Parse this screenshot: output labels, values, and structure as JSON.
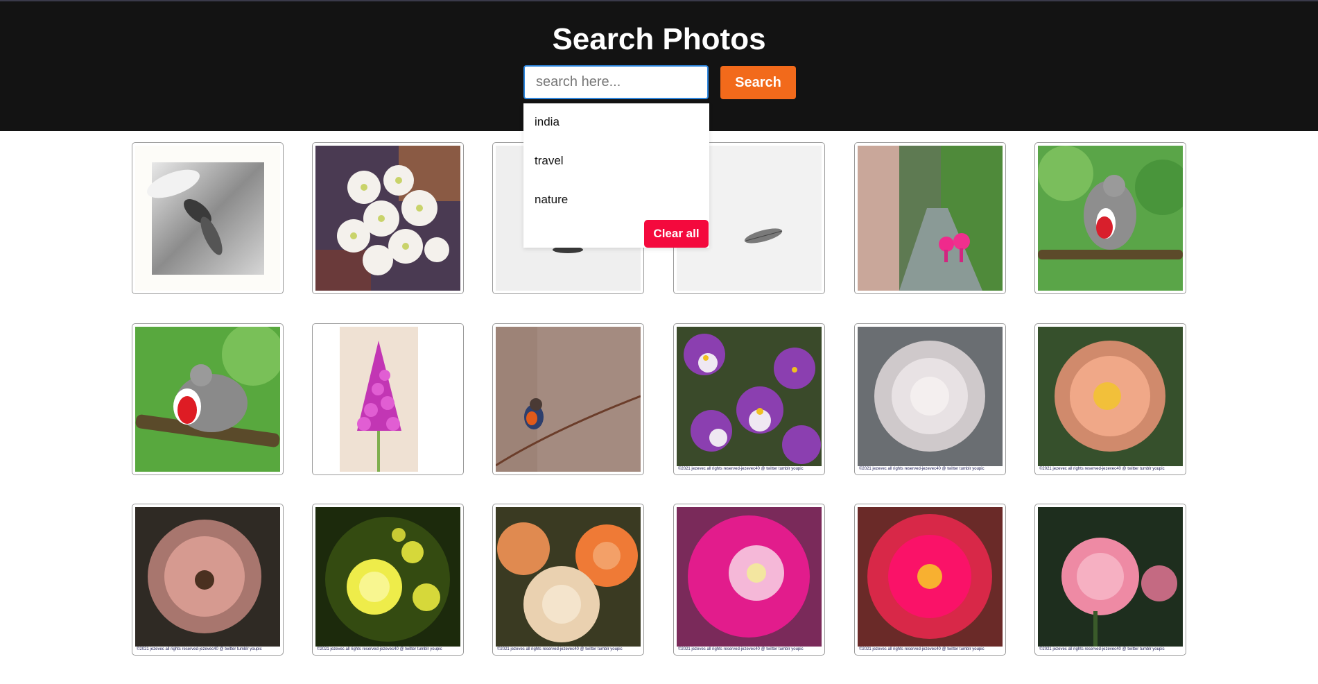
{
  "header": {
    "title": "Search Photos",
    "search_placeholder": "search here...",
    "search_button": "Search"
  },
  "dropdown": {
    "items": [
      "india",
      "travel",
      "nature"
    ],
    "clear_label": "Clear all"
  },
  "photos": [
    {
      "subject": "bee on white flower (black and white)",
      "caption": ""
    },
    {
      "subject": "white cherry blossoms",
      "caption": ""
    },
    {
      "subject": "dark leaf on white",
      "caption": ""
    },
    {
      "subject": "grey leaf on white",
      "caption": ""
    },
    {
      "subject": "people with pink umbrellas on rainy street",
      "caption": ""
    },
    {
      "subject": "dove on branch",
      "caption": ""
    },
    {
      "subject": "dove with red breast on branch",
      "caption": ""
    },
    {
      "subject": "pink pyramidal orchid",
      "caption": ""
    },
    {
      "subject": "bluethroat bird on twig",
      "caption": ""
    },
    {
      "subject": "purple pansies",
      "caption": "©2021 jezevec all rights reserved-jezevec40 @ twitter tumblr youpic"
    },
    {
      "subject": "pale white rose",
      "caption": "©2021 jezevec all rights reserved-jezevec40 @ twitter tumblr youpic"
    },
    {
      "subject": "peach rose",
      "caption": "©2021 jezevec all rights reserved-jezevec40 @ twitter tumblr youpic"
    },
    {
      "subject": "dusty pink rose",
      "caption": "©2021 jezevec all rights reserved-jezevec40 @ twitter tumblr youpic"
    },
    {
      "subject": "yellow roses",
      "caption": "©2021 jezevec all rights reserved-jezevec40 @ twitter tumblr youpic"
    },
    {
      "subject": "cream and orange roses",
      "caption": "©2021 jezevec all rights reserved-jezevec40 @ twitter tumblr youpic"
    },
    {
      "subject": "magenta rose",
      "caption": "©2021 jezevec all rights reserved-jezevec40 @ twitter tumblr youpic"
    },
    {
      "subject": "bright red-pink rose",
      "caption": "©2021 jezevec all rights reserved-jezevec40 @ twitter tumblr youpic"
    },
    {
      "subject": "pink rose on dark background",
      "caption": "©2021 jezevec all rights reserved-jezevec40 @ twitter tumblr youpic"
    }
  ],
  "colors": {
    "header_bg": "#131313",
    "search_button": "#f26a1b",
    "clear_button": "#f4093d",
    "input_border": "#2e86de"
  }
}
